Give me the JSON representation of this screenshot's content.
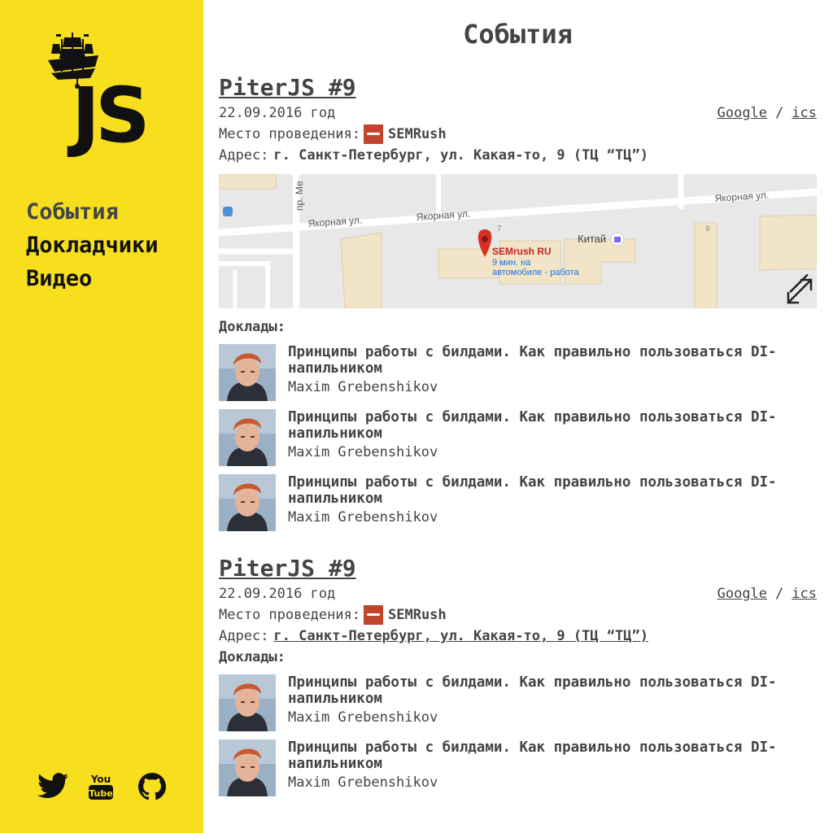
{
  "sidebar": {
    "logo_text": "JS",
    "nav": [
      {
        "label": "События"
      },
      {
        "label": "Докладчики"
      },
      {
        "label": "Видео"
      }
    ],
    "social": [
      "twitter-icon",
      "youtube-icon",
      "github-icon"
    ]
  },
  "page": {
    "title": "События"
  },
  "events": [
    {
      "title": "PiterJS #9",
      "date": "22.09.2016 год",
      "links": {
        "google": "Google",
        "sep": "/",
        "ics": "ics"
      },
      "venue_label": "Место проведения:",
      "venue": "SEMRush",
      "address_label": "Адрес:",
      "address": "г. Санкт-Петербург, ул. Какая-то, 9 (ТЦ “ТЦ”)",
      "map": {
        "streets": [
          "Якорная ул.",
          "Якорная ул.",
          "Якорная ул.",
          "пр. Ме"
        ],
        "house_numbers": [
          "7",
          "9"
        ],
        "poi": "Китай",
        "marker_title": "SEMrush RU",
        "marker_sub1": "9 мин. на",
        "marker_sub2": "автомобиле - работа"
      },
      "talks_label": "Доклады:",
      "talks": [
        {
          "title": "Принципы работы с билдами. Как правильно пользоваться DI-напильником",
          "author": "Maxim Grebenshikov"
        },
        {
          "title": "Принципы работы с билдами. Как правильно пользоваться DI-напильником",
          "author": "Maxim Grebenshikov"
        },
        {
          "title": "Принципы работы с билдами. Как правильно пользоваться DI-напильником",
          "author": "Maxim Grebenshikov"
        }
      ]
    },
    {
      "title": "PiterJS #9",
      "date": "22.09.2016 год",
      "links": {
        "google": "Google",
        "sep": "/",
        "ics": "ics"
      },
      "venue_label": "Место проведения:",
      "venue": "SEMRush",
      "address_label": "Адрес:",
      "address": "г. Санкт-Петербург, ул. Какая-то, 9 (ТЦ “ТЦ”)",
      "talks_label": "Доклады:",
      "talks": [
        {
          "title": "Принципы работы с билдами. Как правильно пользоваться DI-напильником",
          "author": "Maxim Grebenshikov"
        },
        {
          "title": "Принципы работы с билдами. Как правильно пользоваться DI-напильником",
          "author": "Maxim Grebenshikov"
        }
      ]
    }
  ],
  "colors": {
    "sidebar": "#f7df1e",
    "text": "#444444",
    "marker": "#d93025"
  }
}
